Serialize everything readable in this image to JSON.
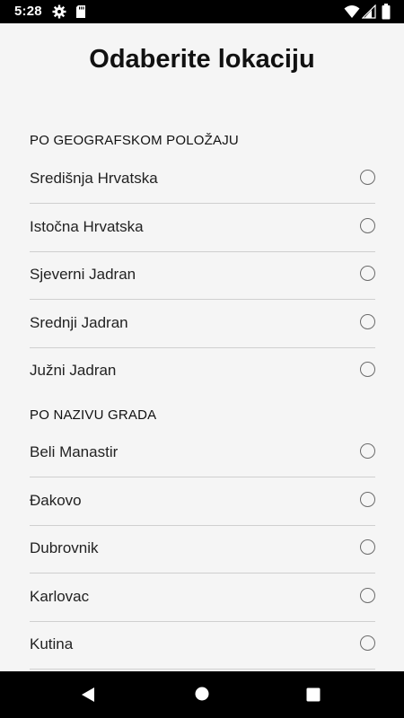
{
  "status_bar": {
    "time": "5:28"
  },
  "title": "Odaberite lokaciju",
  "sections": [
    {
      "header": "PO GEOGRAFSKOM POLOŽAJU",
      "items": [
        "Središnja Hrvatska",
        "Istočna Hrvatska",
        "Sjeverni Jadran",
        "Srednji Jadran",
        "Južni Jadran"
      ]
    },
    {
      "header": "PO NAZIVU GRADA",
      "items": [
        "Beli Manastir",
        "Đakovo",
        "Dubrovnik",
        "Karlovac",
        "Kutina"
      ]
    }
  ],
  "icons": {
    "status": [
      "gear-icon",
      "sd-card-icon",
      "wifi-icon",
      "signal-icon",
      "battery-icon"
    ],
    "nav": [
      "back-icon",
      "home-icon",
      "recents-icon"
    ]
  },
  "colors": {
    "background": "#f5f5f5",
    "divider": "#cfcfcf",
    "bars": "#000000"
  }
}
